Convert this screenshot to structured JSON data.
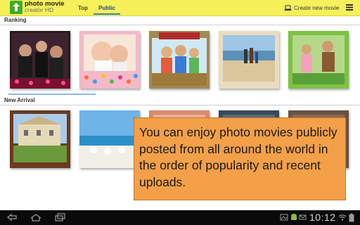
{
  "app": {
    "title_line1": "photo movie",
    "title_line2": "creator HD",
    "icon": "app-logo-icon"
  },
  "tabs": [
    {
      "label": "Top",
      "selected": false
    },
    {
      "label": "Public",
      "selected": true
    }
  ],
  "toolbar": {
    "create_label": "Create new movie",
    "create_icon": "laptop-icon",
    "menu_icon": "menu-icon"
  },
  "sections": {
    "ranking": "Ranking",
    "new_arrival": "New Arrival"
  },
  "callout": {
    "text": "You can enjoy photo movies publicly posted from all around the world in the order of popularity and recent uploads."
  },
  "system_bar": {
    "time": "10:12",
    "icons": [
      "back-icon",
      "home-icon",
      "recent-apps-icon",
      "gallery-icon",
      "android-icon",
      "email-icon",
      "wifi-icon",
      "battery-icon"
    ]
  },
  "colors": {
    "topbar": "#f6f05a",
    "accent": "#2f7fd6",
    "callout": "#f3a049",
    "system_bar": "#0a0a0a"
  }
}
